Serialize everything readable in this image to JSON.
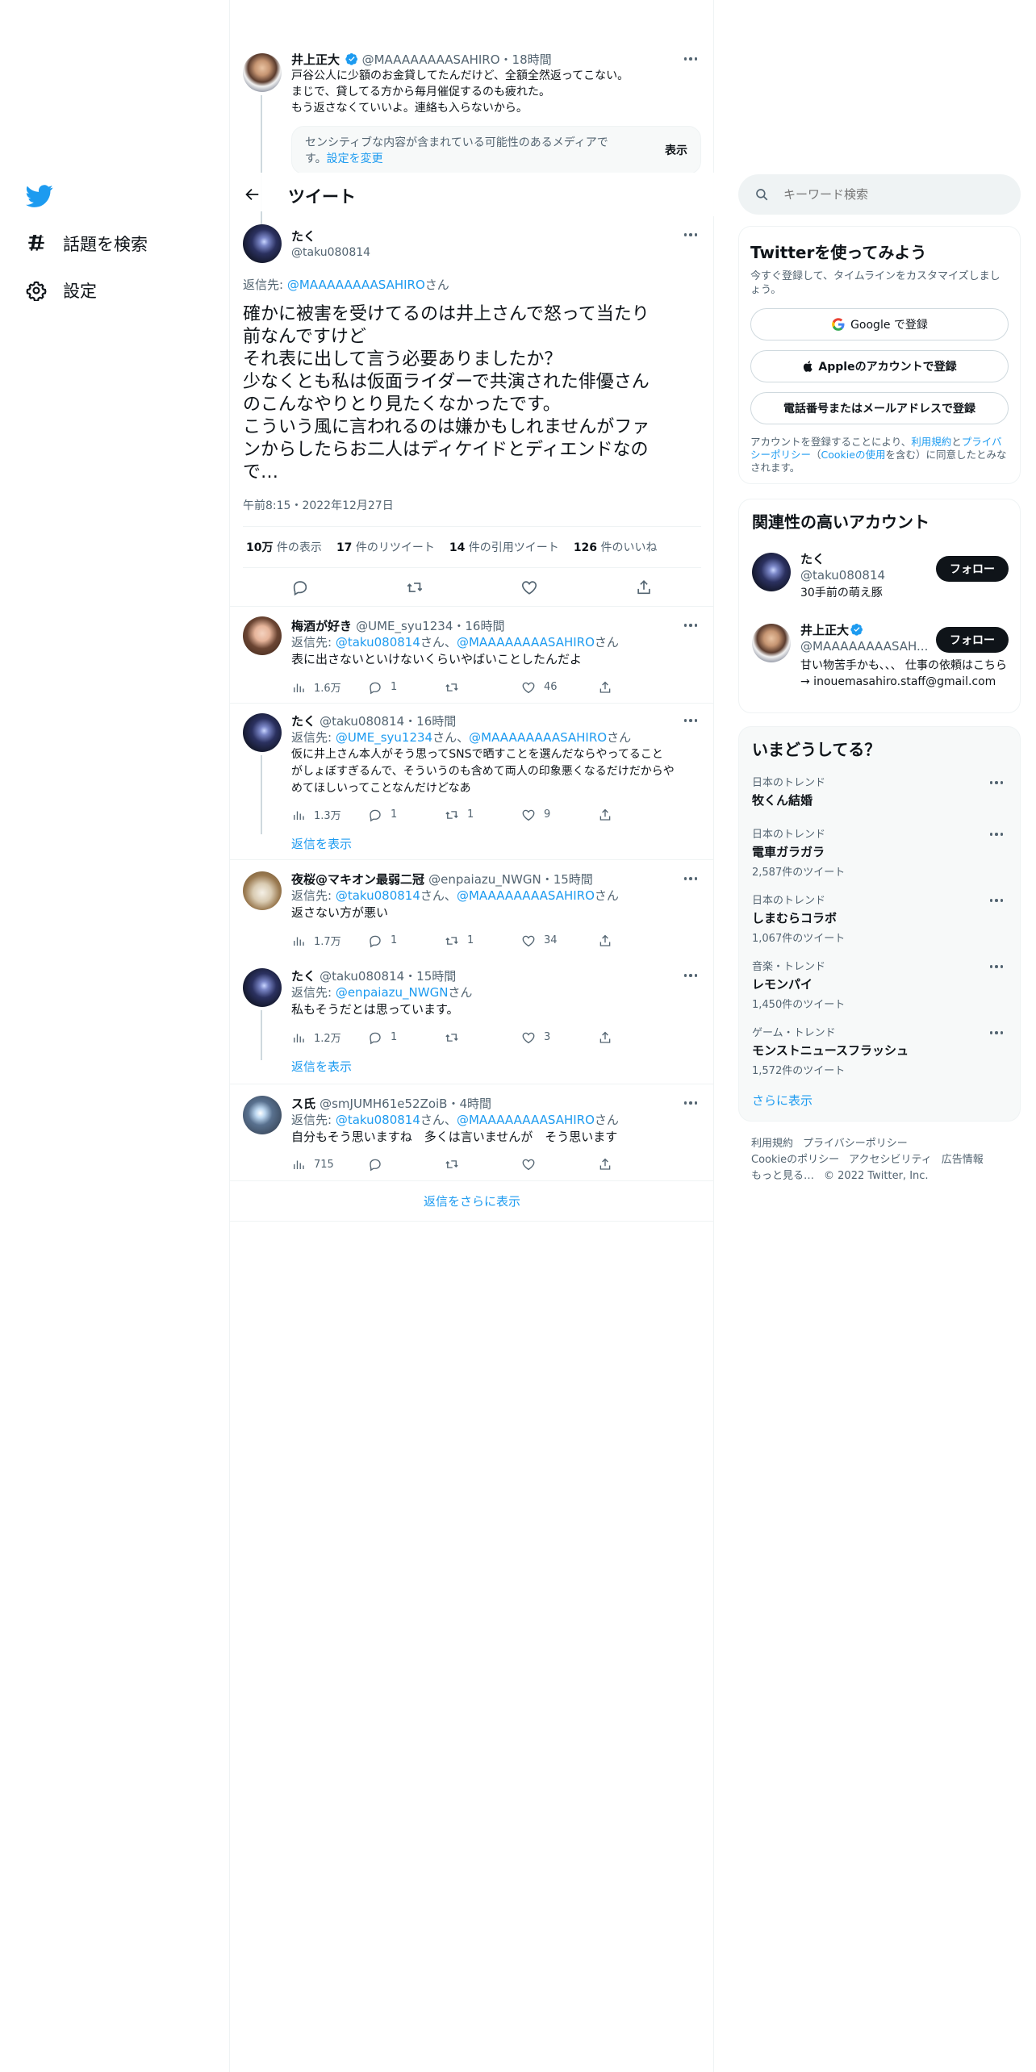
{
  "nav": {
    "explore_label": "話題を検索",
    "settings_label": "設定"
  },
  "top_tweet": {
    "name": "井上正大",
    "handle": "@MAAAAAAAASAHIRO",
    "time": "・18時間",
    "lines": [
      "戸谷公人に少額のお金貸してたんだけど、全額全然返ってこない。",
      "まじで、貸してる方から毎月催促するのも疲れた。",
      "もう返さなくていいよ。連絡も入らないから。"
    ],
    "sensitive_text": "センシティブな内容が含まれている可能性のあるメディアで",
    "sensitive_text2": "す。",
    "sensitive_link": "設定を変更",
    "show_label": "表示"
  },
  "header": {
    "title": "ツイート"
  },
  "main_tweet": {
    "name": "たく",
    "handle": "@taku080814",
    "reply_prefix": "返信先: ",
    "reply_to": "@MAAAAAAAASAHIRO",
    "reply_suffix": "さん",
    "lines": [
      "確かに被害を受けてるのは井上さんで怒って当たり",
      "前なんですけど",
      "それ表に出して言う必要ありましたか？",
      "少なくとも私は仮面ライダーで共演された俳優さん",
      "のこんなやりとり見たくなかったです。",
      "こういう風に言われるのは嫌かもしれませんがファ",
      "ンからしたらお二人はディケイドとディエンドなの",
      "で…"
    ],
    "timestamp": "午前8:15・2022年12月27日",
    "stats": [
      {
        "num": "10万",
        "label": " 件の表示"
      },
      {
        "num": "17",
        "label": " 件のリツイート"
      },
      {
        "num": "14",
        "label": " 件の引用ツイート"
      },
      {
        "num": "126",
        "label": " 件のいいね"
      }
    ]
  },
  "replies": [
    {
      "name": "梅酒が好き",
      "handle": "@UME_syu1234・16時間",
      "to": [
        "@taku080814",
        "@MAAAAAAAASAHIRO"
      ],
      "text": [
        "表に出さないといけないくらいやばいことしたんだよ"
      ],
      "views": "1.6万",
      "replies": "1",
      "rts": "",
      "likes": "46"
    },
    {
      "name": "たく",
      "handle": "@taku080814・16時間",
      "to": [
        "@UME_syu1234",
        "@MAAAAAAAASAHIRO"
      ],
      "text": [
        "仮に井上さん本人がそう思ってSNSで晒すことを選んだならやってること",
        "がしょぼすぎるんで、そういうのも含めて両人の印象悪くなるだけだからや",
        "めてほしいってことなんだけどなあ"
      ],
      "views": "1.3万",
      "replies": "1",
      "rts": "1",
      "likes": "9"
    },
    {
      "name": "夜桜@マキオン最弱二冠",
      "handle": "@enpaiazu_NWGN・15時間",
      "to": [
        "@taku080814",
        "@MAAAAAAAASAHIRO"
      ],
      "text": [
        "返さない方が悪い"
      ],
      "views": "1.7万",
      "replies": "1",
      "rts": "1",
      "likes": "34"
    },
    {
      "name": "たく",
      "handle": "@taku080814・15時間",
      "to": [
        "@enpaiazu_NWGN"
      ],
      "text": [
        "私もそうだとは思っています。"
      ],
      "views": "1.2万",
      "replies": "1",
      "rts": "",
      "likes": "3"
    },
    {
      "name": "ス氏",
      "handle": "@smJUMH61e52ZoiB・4時間",
      "to": [
        "@taku080814",
        "@MAAAAAAAASAHIRO"
      ],
      "text": [
        "自分もそう思いますね　多くは言いませんが　そう思います"
      ],
      "views": "715",
      "replies": "",
      "rts": "",
      "likes": ""
    }
  ],
  "reply_common": {
    "prefix": "返信先: ",
    "san": "さん",
    "sep": "、",
    "show_replies": "返信を表示",
    "show_more_replies": "返信をさらに表示"
  },
  "right": {
    "search_placeholder": "キーワード検索",
    "signup": {
      "title": "Twitterを使ってみよう",
      "desc": "今すぐ登録して、タイムラインをカスタマイズしましょう。",
      "google": "Google で登録",
      "apple": "Appleのアカウントで登録",
      "phone": "電話番号またはメールアドレスで登録",
      "legal_1": "アカウントを登録することにより、",
      "legal_terms": "利用規約",
      "legal_2": "と",
      "legal_privacy": "プライバシーポリシー",
      "legal_3": "（",
      "legal_cookie": "Cookieの使用",
      "legal_4": "を含む）に同意したとみなされます。"
    },
    "related": {
      "title": "関連性の高いアカウント",
      "follow": "フォロー",
      "accounts": [
        {
          "name": "たく",
          "handle": "@taku080814",
          "bio": "30手前の萌え豚"
        },
        {
          "name": "井上正大",
          "handle": "@MAAAAAAAASAH...",
          "bio": "甘い物苦手かも、、、 仕事の依頼はこちら→ inouemasahiro.staff@gmail.com"
        }
      ]
    },
    "trends": {
      "title": "いまどうしてる？",
      "items": [
        {
          "context": "日本のトレンド",
          "name": "牧くん結婚",
          "count": ""
        },
        {
          "context": "日本のトレンド",
          "name": "電車ガラガラ",
          "count": "2,587件のツイート"
        },
        {
          "context": "日本のトレンド",
          "name": "しまむらコラボ",
          "count": "1,067件のツイート"
        },
        {
          "context": "音楽・トレンド",
          "name": "レモンパイ",
          "count": "1,450件のツイート"
        },
        {
          "context": "ゲーム・トレンド",
          "name": "モンストニュースフラッシュ",
          "count": "1,572件のツイート"
        }
      ],
      "show_more": "さらに表示"
    },
    "footer": [
      "利用規約",
      "プライバシーポリシー",
      "Cookieのポリシー",
      "アクセシビリティ",
      "広告情報",
      "もっと見る…",
      "© 2022 Twitter, Inc."
    ]
  }
}
